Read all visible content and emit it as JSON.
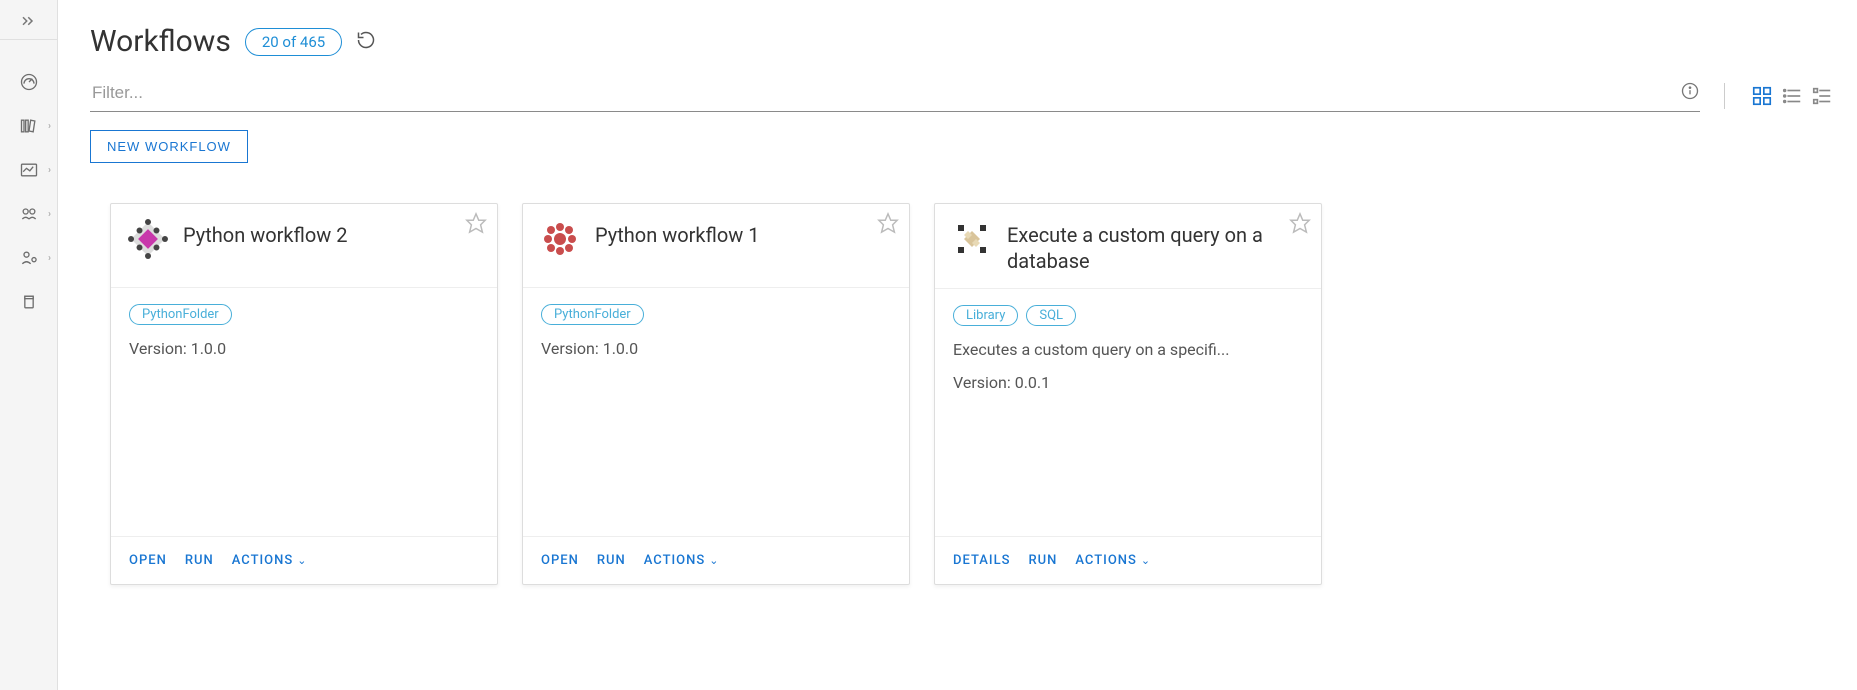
{
  "header": {
    "title": "Workflows",
    "count_badge": "20 of 465"
  },
  "filter": {
    "placeholder": "Filter..."
  },
  "actions": {
    "new_workflow": "NEW WORKFLOW"
  },
  "cards": [
    {
      "title": "Python workflow 2",
      "tags": [
        "PythonFolder"
      ],
      "description": "",
      "version": "Version: 1.0.0",
      "footer": [
        "OPEN",
        "RUN",
        "ACTIONS"
      ]
    },
    {
      "title": "Python workflow 1",
      "tags": [
        "PythonFolder"
      ],
      "description": "",
      "version": "Version: 1.0.0",
      "footer": [
        "OPEN",
        "RUN",
        "ACTIONS"
      ]
    },
    {
      "title": "Execute a custom query on a database",
      "tags": [
        "Library",
        "SQL"
      ],
      "description": "Executes a custom query on a specifi...",
      "version": "Version: 0.0.1",
      "footer": [
        "DETAILS",
        "RUN",
        "ACTIONS"
      ]
    }
  ]
}
